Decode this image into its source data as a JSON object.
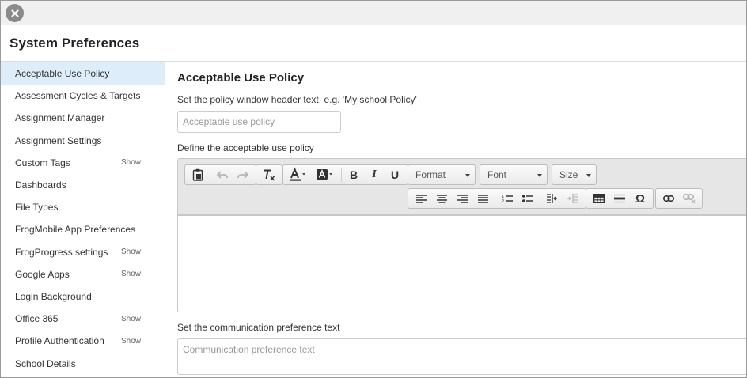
{
  "header": {
    "title": "System Preferences"
  },
  "sidebar": {
    "items": [
      {
        "label": "Acceptable Use Policy",
        "show": ""
      },
      {
        "label": "Assessment Cycles & Targets",
        "show": ""
      },
      {
        "label": "Assignment Manager",
        "show": ""
      },
      {
        "label": "Assignment Settings",
        "show": ""
      },
      {
        "label": "Custom Tags",
        "show": "Show"
      },
      {
        "label": "Dashboards",
        "show": ""
      },
      {
        "label": "File Types",
        "show": ""
      },
      {
        "label": "FrogMobile App Preferences",
        "show": ""
      },
      {
        "label": "FrogProgress settings",
        "show": "Show"
      },
      {
        "label": "Google Apps",
        "show": "Show"
      },
      {
        "label": "Login Background",
        "show": ""
      },
      {
        "label": "Office 365",
        "show": "Show"
      },
      {
        "label": "Profile Authentication",
        "show": "Show"
      },
      {
        "label": "School Details",
        "show": ""
      }
    ],
    "active_index": 0
  },
  "main": {
    "title": "Acceptable Use Policy",
    "header_label": "Set the policy window header text, e.g. 'My school Policy'",
    "header_placeholder": "Acceptable use policy",
    "policy_label": "Define the acceptable use policy",
    "comm_label": "Set the communication preference text",
    "comm_placeholder": "Communication preference text"
  },
  "toolbar": {
    "format_label": "Format",
    "font_label": "Font",
    "size_label": "Size"
  },
  "colors": {
    "active_item_bg": "#ddeefa",
    "toolbar_bg": "#e6e6e6",
    "close_button": "#8a8a8a"
  }
}
